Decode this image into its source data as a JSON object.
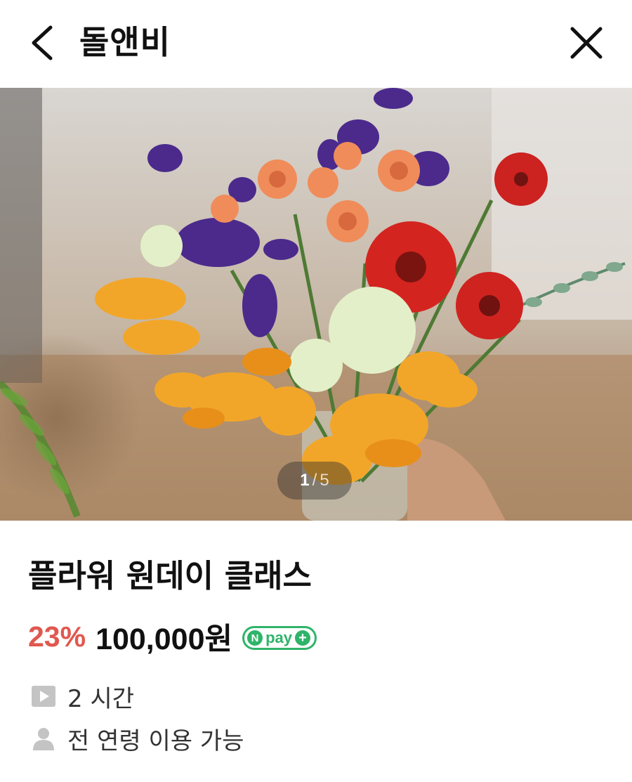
{
  "header": {
    "title": "돌앤비",
    "back_icon": "chevron-left-icon",
    "close_icon": "close-icon"
  },
  "carousel": {
    "current": "1",
    "separator": "/",
    "total": "5"
  },
  "product": {
    "title": "플라워 원데이 클래스",
    "discount": "23%",
    "price": "100,000원",
    "npay": {
      "n_label": "N",
      "label": "pay",
      "plus": "+"
    }
  },
  "details": {
    "duration": "2 시간",
    "age": "전 연령 이용 가능"
  },
  "colors": {
    "discount": "#e0584f",
    "npay_green": "#2fb469",
    "text": "#111111"
  }
}
